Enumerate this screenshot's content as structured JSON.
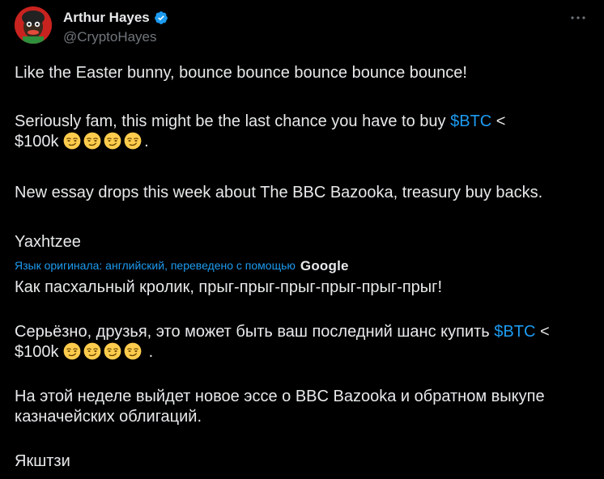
{
  "author": {
    "display_name": "Arthur Hayes",
    "handle": "@CryptoHayes"
  },
  "post": {
    "line1": "Like the Easter bunny, bounce bounce bounce bounce bounce!",
    "line2_prefix": "Seriously fam, this might be the last chance you have to buy ",
    "cashtag": "$BTC",
    "line2_suffix": " <",
    "price": "$100k",
    "emoji_count": 4,
    "emoji_name": "smirking-face",
    "line2_end": ".",
    "line3": "New essay drops this week about The BBC Bazooka, treasury buy backs.",
    "signature": "Yaxhtzee"
  },
  "translation": {
    "note": "Язык оригинала: английский, переведено с помощью",
    "provider": "Google",
    "line1": "Как пасхальный кролик, прыг-прыг-прыг-прыг-прыг-прыг!",
    "line2_prefix": "Серьёзно, друзья, это может быть ваш последний шанс купить ",
    "cashtag": "$BTC",
    "line2_suffix": " <",
    "price": "$100k",
    "line2_end": " .",
    "line3": "На этой неделе выйдет новое эссе о BBC Bazooka и обратном выкупе казначейских облигаций.",
    "signature": "Якштзи"
  },
  "colors": {
    "background": "#000000",
    "text": "#e7e9ea",
    "secondary": "#71767b",
    "link": "#1d9bf0",
    "verified": "#1d9bf0"
  },
  "icons": {
    "verified": "verified-badge-icon",
    "more": "more-options-icon"
  }
}
